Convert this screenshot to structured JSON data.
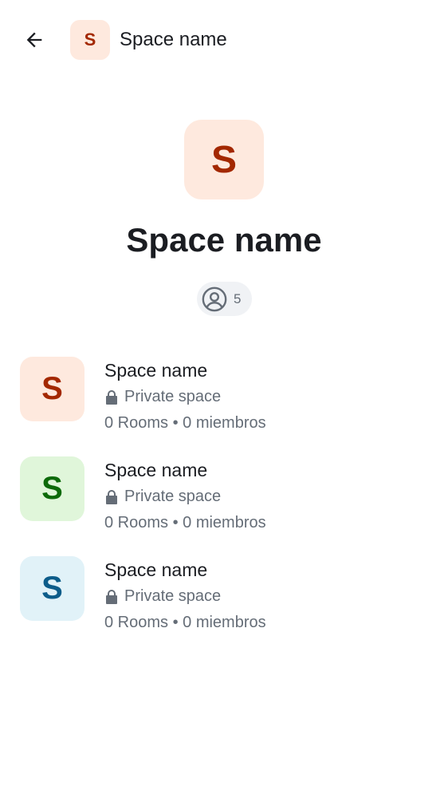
{
  "topbar": {
    "back_icon": "arrow-left-icon",
    "avatar_letter": "S",
    "avatar_bg": "#fee9de",
    "avatar_fg": "#a32800",
    "title": "Space name"
  },
  "hero": {
    "avatar_letter": "S",
    "avatar_bg": "#fee9de",
    "avatar_fg": "#a32800",
    "title": "Space name",
    "member_icon": "user-circle-icon",
    "member_count": "5"
  },
  "spaces": [
    {
      "avatar_letter": "S",
      "avatar_bg": "#fee9de",
      "avatar_fg": "#a32800",
      "name": "Space name",
      "privacy_icon": "lock-icon",
      "privacy": "Private space",
      "meta": "0 Rooms • 0 miembros"
    },
    {
      "avatar_letter": "S",
      "avatar_bg": "#e0f6da",
      "avatar_fg": "#0d6a0a",
      "name": "Space name",
      "privacy_icon": "lock-icon",
      "privacy": "Private space",
      "meta": "0 Rooms • 0 miembros"
    },
    {
      "avatar_letter": "S",
      "avatar_bg": "#e1f2f8",
      "avatar_fg": "#0d5d8a",
      "name": "Space name",
      "privacy_icon": "lock-icon",
      "privacy": "Private space",
      "meta": "0 Rooms • 0 miembros"
    }
  ]
}
